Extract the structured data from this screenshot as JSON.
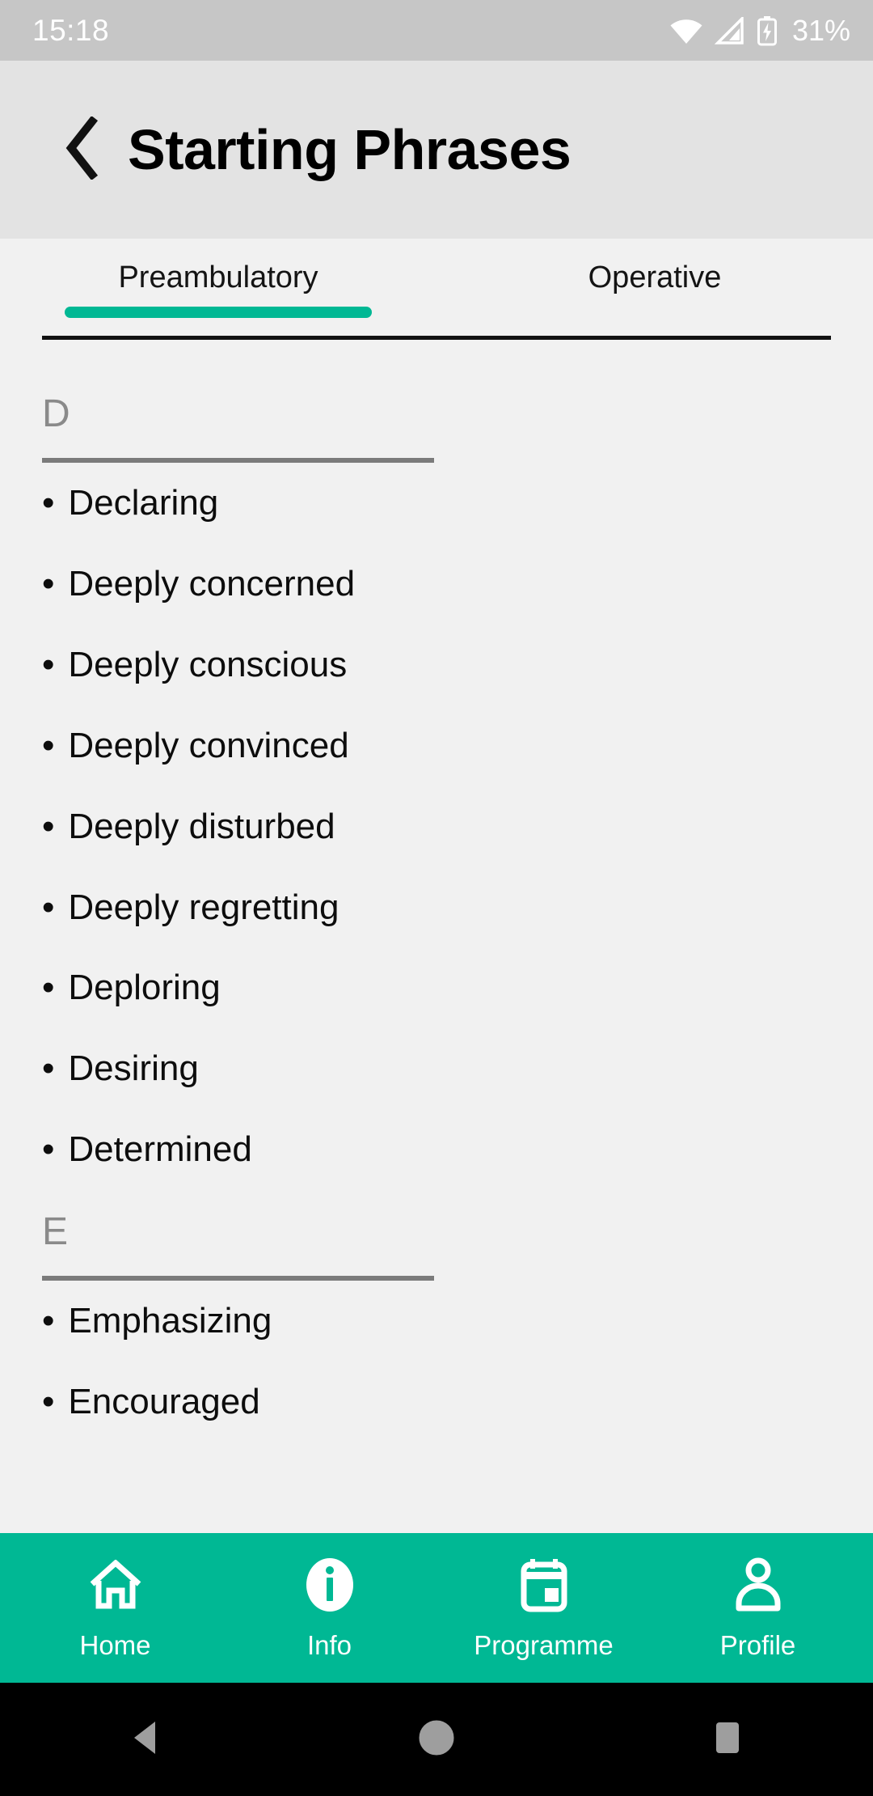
{
  "status_bar": {
    "clock": "15:18",
    "battery_percent": "31%",
    "icons": [
      "wifi-icon",
      "cellular-signal-icon",
      "battery-charging-icon"
    ]
  },
  "app_bar": {
    "back_icon": "back-chevron-icon",
    "title": "Starting Phrases"
  },
  "tabs": {
    "items": [
      {
        "label": "Preambulatory",
        "active": true
      },
      {
        "label": "Operative",
        "active": false
      }
    ]
  },
  "list": {
    "sections": [
      {
        "letter": "D",
        "items": [
          "Declaring",
          "Deeply concerned",
          "Deeply conscious",
          "Deeply convinced",
          "Deeply disturbed",
          "Deeply regretting",
          "Deploring",
          "Desiring",
          "Determined"
        ]
      },
      {
        "letter": "E",
        "items": [
          "Emphasizing",
          "Encouraged"
        ]
      }
    ],
    "bullet": "•"
  },
  "bottom_nav": {
    "items": [
      {
        "label": "Home",
        "icon": "home-icon"
      },
      {
        "label": "Info",
        "icon": "info-icon"
      },
      {
        "label": "Programme",
        "icon": "calendar-icon"
      },
      {
        "label": "Profile",
        "icon": "person-icon"
      }
    ]
  },
  "system_nav": {
    "back": "back-triangle-icon",
    "home": "home-circle-icon",
    "recents": "recents-square-icon"
  },
  "colors": {
    "accent": "#00b894",
    "status_bar_bg": "#c6c6c6",
    "app_bar_bg": "#e3e3e3",
    "page_bg": "#f1f1f1",
    "section_letter": "#8a8a8a",
    "text": "#0d0d0d"
  }
}
